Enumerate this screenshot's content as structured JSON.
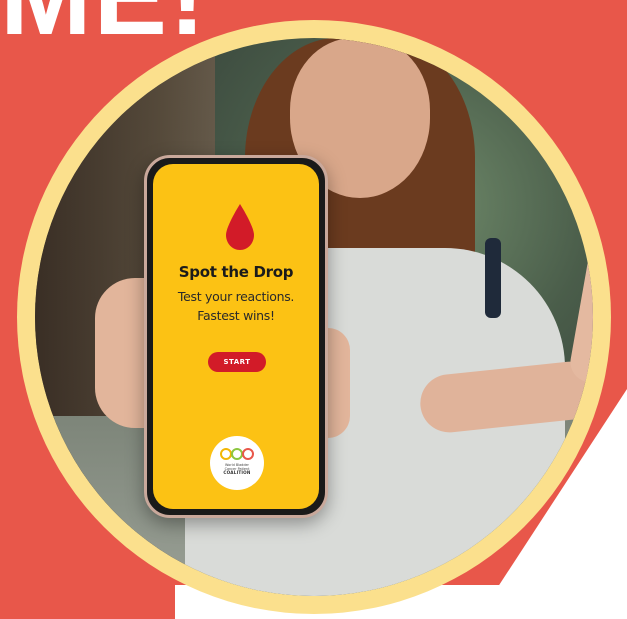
{
  "headline": "ME!",
  "app": {
    "title": "Spot the Drop",
    "subtitle_line1": "Test your reactions.",
    "subtitle_line2": "Fastest wins!",
    "start_label": "START",
    "drop_icon": "blood-drop-icon",
    "logo": {
      "line1": "World Bladder",
      "line2": "Cancer Patient",
      "line3": "COALITION"
    }
  },
  "colors": {
    "background": "#e8574a",
    "ring": "#fbe08d",
    "screen": "#fcc214",
    "button": "#d21b28"
  }
}
